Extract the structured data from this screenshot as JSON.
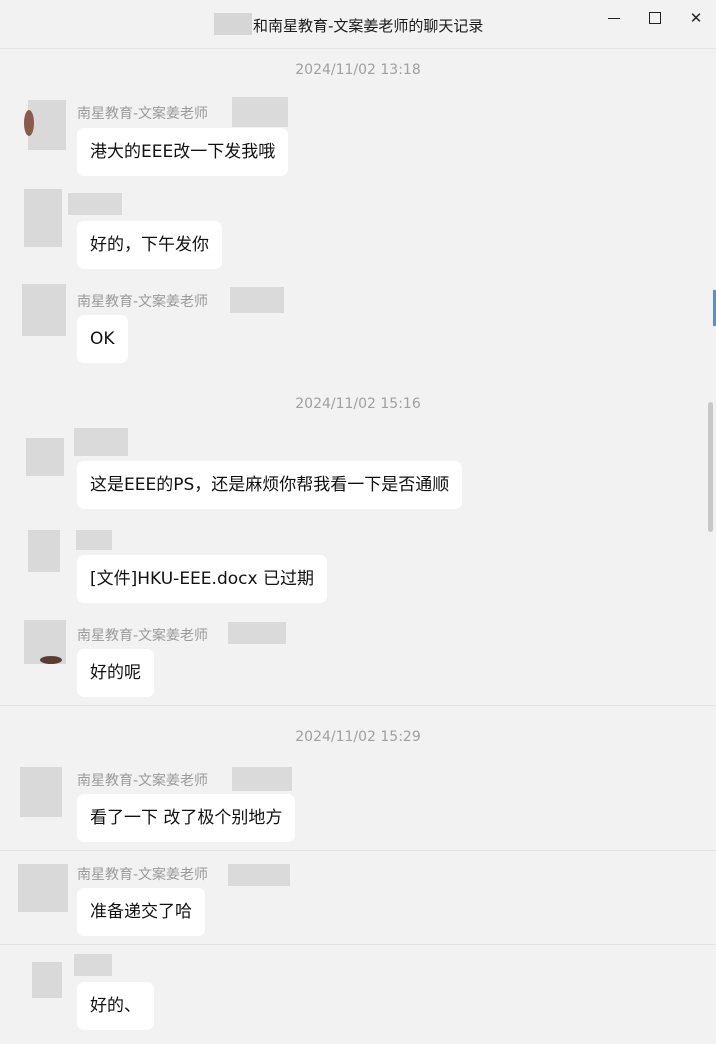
{
  "window": {
    "title": "和南星教育-文案姜老师的聊天记录",
    "controls": {
      "minimize": "minimize",
      "maximize": "maximize",
      "close": "✕"
    }
  },
  "chat": {
    "timestamps": [
      "2024/11/02 13:18",
      "2024/11/02 15:16",
      "2024/11/02 15:29"
    ],
    "messages": [
      {
        "sender": "南星教育-文案姜老师",
        "text": "港大的EEE改一下发我哦"
      },
      {
        "sender": "",
        "text": "好的，下午发你"
      },
      {
        "sender": "南星教育-文案姜老师",
        "text": "OK"
      },
      {
        "sender": "",
        "text": "这是EEE的PS，还是麻烦你帮我看一下是否通顺"
      },
      {
        "sender": "",
        "text": "[文件]HKU-EEE.docx 已过期"
      },
      {
        "sender": "南星教育-文案姜老师",
        "text": "好的呢"
      },
      {
        "sender": "南星教育-文案姜老师",
        "text": "看了一下 改了极个别地方"
      },
      {
        "sender": "南星教育-文案姜老师",
        "text": "准备递交了哈"
      },
      {
        "sender": "",
        "text": "好的、"
      }
    ]
  },
  "colors": {
    "background": "#f2f2f2",
    "bubble": "#ffffff",
    "sender_text": "#9a9a9a",
    "timestamp_text": "#a0a0a0"
  }
}
